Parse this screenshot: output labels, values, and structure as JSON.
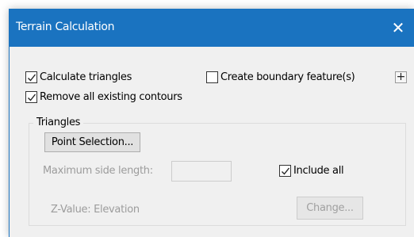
{
  "window": {
    "title": "Terrain Calculation",
    "close_symbol": "✕"
  },
  "options": {
    "calculate_triangles": {
      "label": "Calculate triangles",
      "checked": true
    },
    "create_boundary": {
      "label": "Create boundary feature(s)",
      "checked": false
    },
    "remove_contours": {
      "label": "Remove all existing contours",
      "checked": true
    },
    "expand_symbol": "+"
  },
  "triangles_group": {
    "label": "Triangles",
    "point_selection_label": "Point Selection...",
    "max_side_label": "Maximum side length:",
    "max_side_value": "",
    "include_all": {
      "label": "Include all",
      "checked": true
    },
    "z_value_label": "Z-Value: Elevation",
    "change_label": "Change..."
  },
  "colors": {
    "accent": "#1a73c0",
    "window_bg": "#f0f0f0",
    "disabled_text": "#9c9c9c"
  }
}
